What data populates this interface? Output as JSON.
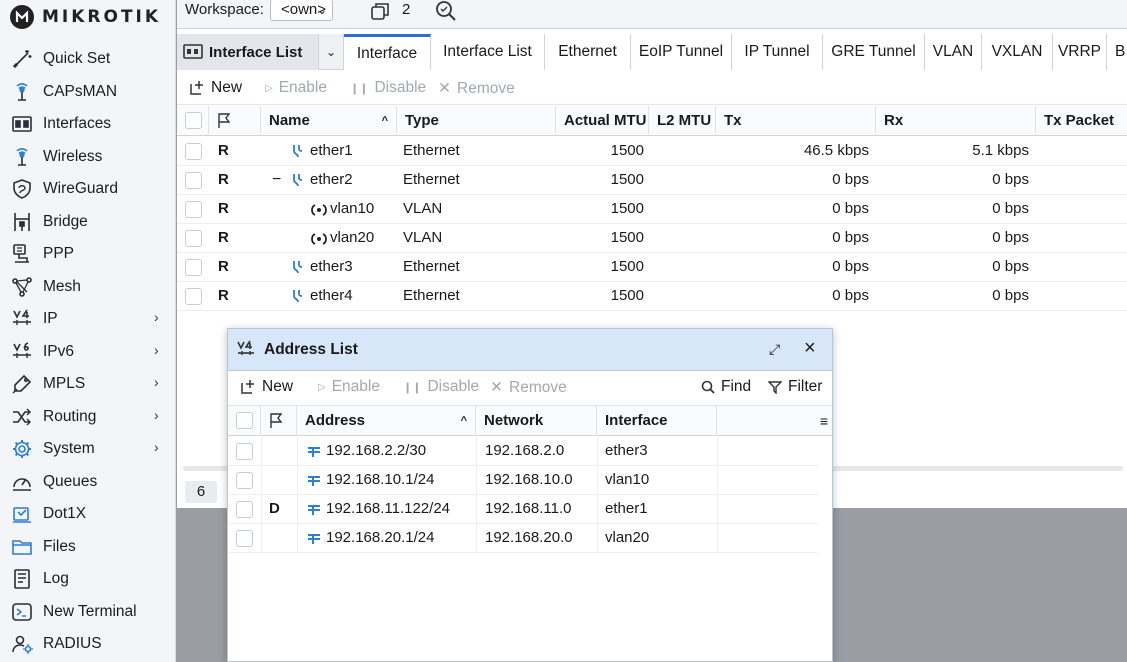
{
  "brand": "MIKROTIK",
  "sidebar": {
    "items": [
      {
        "label": "Quick Set",
        "icon": "wand-icon",
        "arrow": false
      },
      {
        "label": "CAPsMAN",
        "icon": "antenna-icon",
        "arrow": false
      },
      {
        "label": "Interfaces",
        "icon": "interface-card-icon",
        "arrow": false
      },
      {
        "label": "Wireless",
        "icon": "wifi-icon",
        "arrow": false
      },
      {
        "label": "WireGuard",
        "icon": "shield-icon",
        "arrow": false
      },
      {
        "label": "Bridge",
        "icon": "bridge-icon",
        "arrow": false
      },
      {
        "label": "PPP",
        "icon": "ppp-icon",
        "arrow": false
      },
      {
        "label": "Mesh",
        "icon": "mesh-icon",
        "arrow": false
      },
      {
        "label": "IP",
        "icon": "ipv4-icon",
        "arrow": true
      },
      {
        "label": "IPv6",
        "icon": "ipv6-icon",
        "arrow": true
      },
      {
        "label": "MPLS",
        "icon": "mpls-icon",
        "arrow": true
      },
      {
        "label": "Routing",
        "icon": "routing-icon",
        "arrow": true
      },
      {
        "label": "System",
        "icon": "gear-icon",
        "arrow": true
      },
      {
        "label": "Queues",
        "icon": "gauge-icon",
        "arrow": false
      },
      {
        "label": "Dot1X",
        "icon": "dot1x-icon",
        "arrow": false
      },
      {
        "label": "Files",
        "icon": "folder-icon",
        "arrow": false
      },
      {
        "label": "Log",
        "icon": "log-icon",
        "arrow": false
      },
      {
        "label": "New Terminal",
        "icon": "terminal-icon",
        "arrow": false
      },
      {
        "label": "RADIUS",
        "icon": "radius-icon",
        "arrow": false
      }
    ],
    "arrow_glyph": "›"
  },
  "workspace": {
    "label": "Workspace:",
    "value": "<own>",
    "window_count": "2"
  },
  "interface_window": {
    "title": "Interface List",
    "tabs": [
      "Interface",
      "Interface List",
      "Ethernet",
      "EoIP Tunnel",
      "IP Tunnel",
      "GRE Tunnel",
      "VLAN",
      "VXLAN",
      "VRRP",
      "B"
    ],
    "toolbar": {
      "new": "New",
      "enable": "Enable",
      "disable": "Disable",
      "remove": "Remove"
    },
    "columns": [
      "Name",
      "Type",
      "Actual MTU",
      "L2 MTU",
      "Tx",
      "Rx",
      "Tx Packet"
    ],
    "rows": [
      {
        "flag": "R",
        "name": "ether1",
        "type": "Ethernet",
        "mtu": "1500",
        "tx": "46.5 kbps",
        "rx": "5.1 kbps",
        "kind": "ether",
        "level": 0,
        "expander": ""
      },
      {
        "flag": "R",
        "name": "ether2",
        "type": "Ethernet",
        "mtu": "1500",
        "tx": "0 bps",
        "rx": "0 bps",
        "kind": "ether",
        "level": 0,
        "expander": "−"
      },
      {
        "flag": "R",
        "name": "vlan10",
        "type": "VLAN",
        "mtu": "1500",
        "tx": "0 bps",
        "rx": "0 bps",
        "kind": "vlan",
        "level": 1,
        "expander": ""
      },
      {
        "flag": "R",
        "name": "vlan20",
        "type": "VLAN",
        "mtu": "1500",
        "tx": "0 bps",
        "rx": "0 bps",
        "kind": "vlan",
        "level": 1,
        "expander": ""
      },
      {
        "flag": "R",
        "name": "ether3",
        "type": "Ethernet",
        "mtu": "1500",
        "tx": "0 bps",
        "rx": "0 bps",
        "kind": "ether",
        "level": 0,
        "expander": ""
      },
      {
        "flag": "R",
        "name": "ether4",
        "type": "Ethernet",
        "mtu": "1500",
        "tx": "0 bps",
        "rx": "0 bps",
        "kind": "ether",
        "level": 0,
        "expander": ""
      }
    ],
    "row_count": "6"
  },
  "address_window": {
    "title": "Address List",
    "toolbar": {
      "new": "New",
      "enable": "Enable",
      "disable": "Disable",
      "remove": "Remove",
      "find": "Find",
      "filter": "Filter"
    },
    "columns": [
      "Address",
      "Network",
      "Interface"
    ],
    "rows": [
      {
        "flag": "",
        "address": "192.168.2.2/30",
        "network": "192.168.2.0",
        "interface": "ether3"
      },
      {
        "flag": "",
        "address": "192.168.10.1/24",
        "network": "192.168.10.0",
        "interface": "vlan10"
      },
      {
        "flag": "D",
        "address": "192.168.11.122/24",
        "network": "192.168.11.0",
        "interface": "ether1"
      },
      {
        "flag": "",
        "address": "192.168.20.1/24",
        "network": "192.168.20.0",
        "interface": "vlan20"
      }
    ]
  },
  "colors": {
    "accent": "#2c6fd1",
    "icon_blue": "#2a7fd6",
    "title_bar": "#d7e6f8"
  }
}
